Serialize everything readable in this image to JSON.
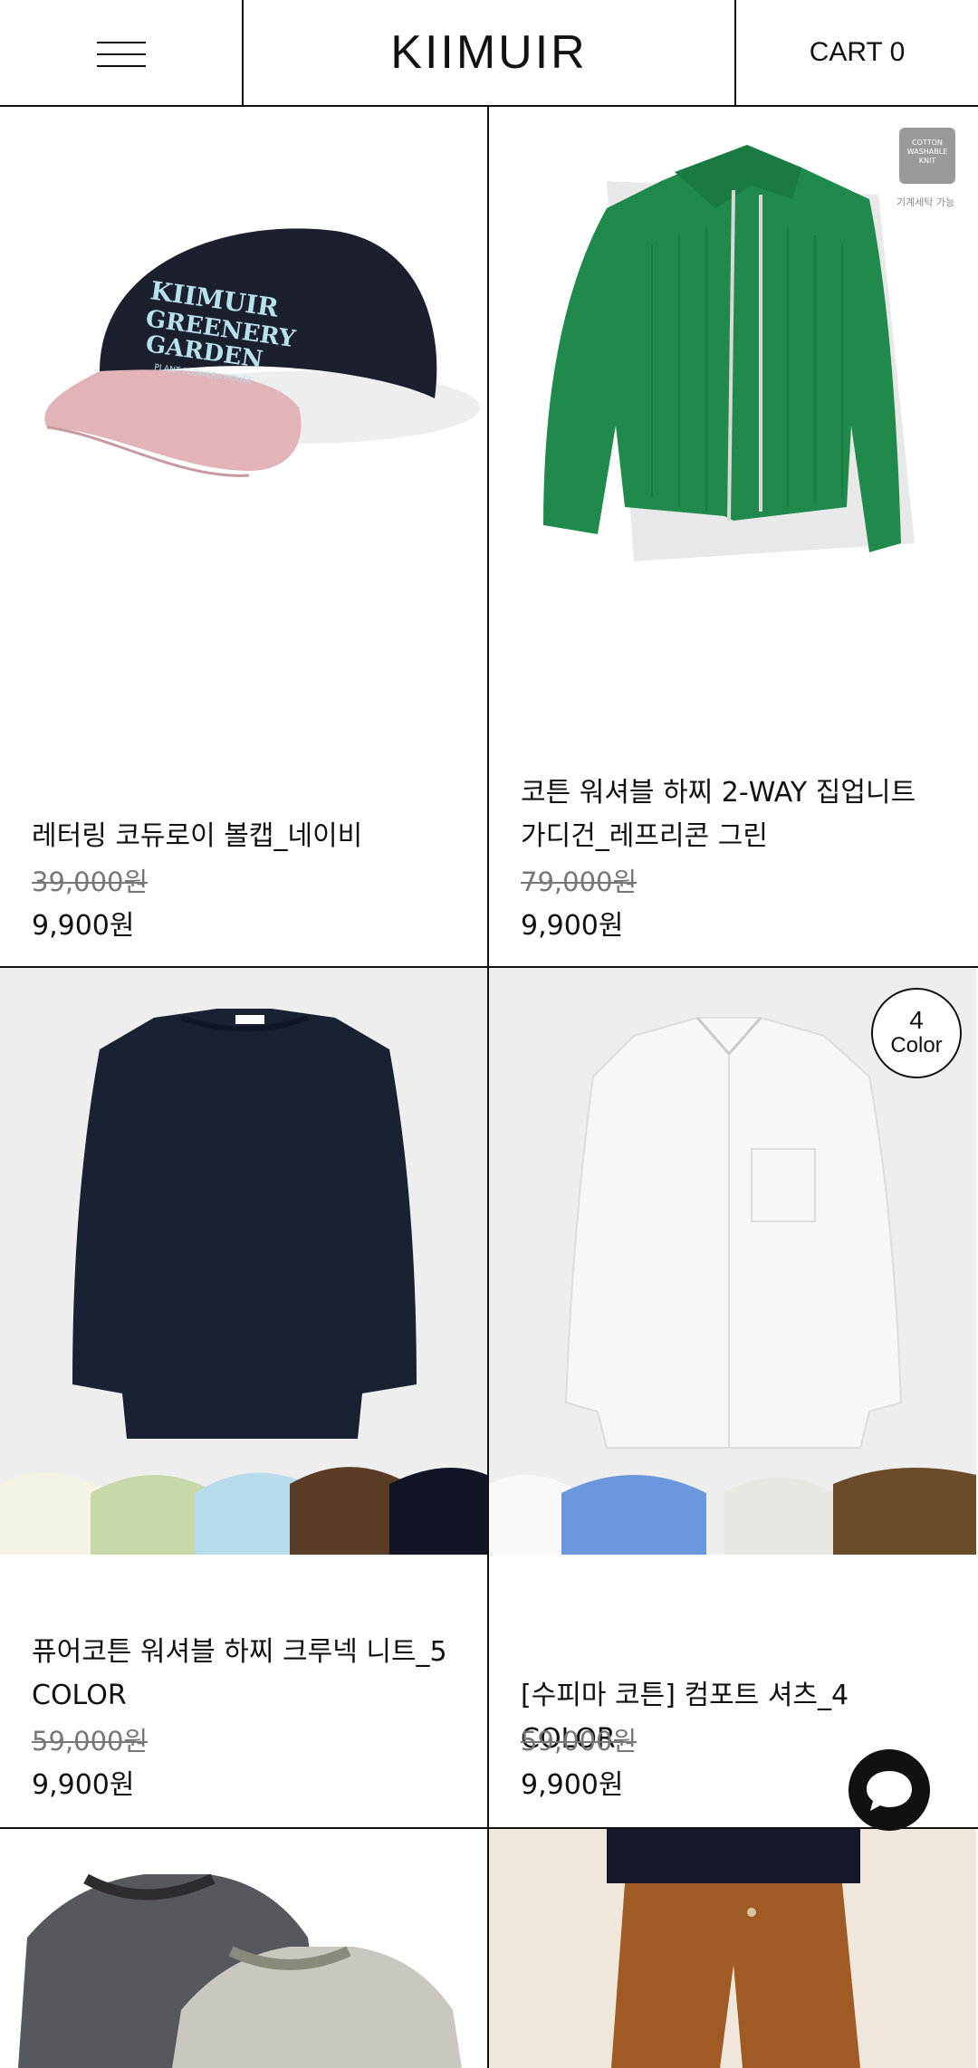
{
  "header": {
    "logo": "KIIMUIR",
    "cart_label": "CART 0"
  },
  "products": [
    {
      "name": "레터링 코듀로이 볼캡_네이비",
      "original_price": "39,000원",
      "sale_price": "9,900원"
    },
    {
      "name": "코튼 워셔블 하찌 2-WAY 집업니트 가디건_레프리콘 그린",
      "original_price": "79,000원",
      "sale_price": "9,900원",
      "badge": {
        "line1": "COTTON",
        "line2": "WASHABLE",
        "line3": "KNIT",
        "caption": "기계세탁 가능"
      }
    },
    {
      "name": "퓨어코튼 워셔블 하찌 크루넥 니트_5 COLOR",
      "original_price": "59,000원",
      "sale_price": "9,900원"
    },
    {
      "name": "[수피마 코튼] 컴포트 셔츠_4 COLOR",
      "original_price": "59,000원",
      "sale_price": "9,900원",
      "color_badge": {
        "count": "4",
        "label": "Color"
      }
    }
  ],
  "colors": {
    "line": "#111111",
    "cap_navy": "#1c1f2e",
    "cap_pink": "#e2b3b8",
    "cardigan_green": "#1f8a4c",
    "sweater_navy": "#1a2133",
    "shirt_white": "#f2f2f2"
  }
}
